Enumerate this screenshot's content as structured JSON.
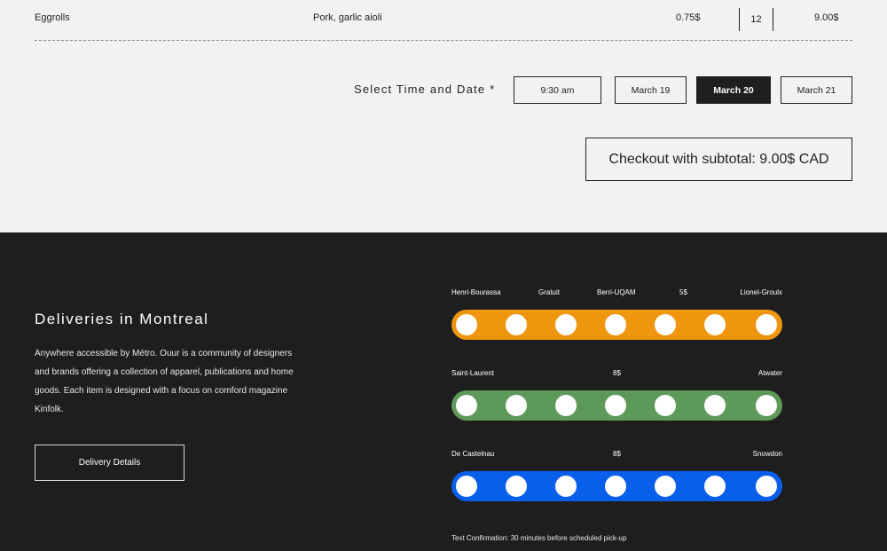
{
  "order": {
    "item_name": "Eggrolls",
    "item_description": "Pork, garlic aioli",
    "unit_price": "0.75$",
    "quantity": "12",
    "line_total": "9.00$"
  },
  "schedule": {
    "label": "Select Time and Date *",
    "time": "9:30 am",
    "dates": [
      "March 19",
      "March 20",
      "March 21"
    ],
    "selected_date": "March 20"
  },
  "checkout": {
    "label": "Checkout with subtotal: 9.00$ CAD"
  },
  "deliveries": {
    "title": "Deliveries in Montreal",
    "body": "Anywhere accessible by Métro. Ouur is a community of designers and brands offering a collection of apparel, publications and home goods. Each item is designed with a focus on comford magazine Kinfolk.",
    "button_label": "Delivery Details"
  },
  "metro_lines": [
    {
      "color": "#f0960e",
      "labels": [
        "Henri-Bourassa",
        "Gratuit",
        "Berri-UQAM",
        "5$",
        "Lionel-Groulx"
      ],
      "stops": 7
    },
    {
      "color": "#5d9a5a",
      "labels": [
        "Saint-Laurent",
        "8$",
        "Atwater"
      ],
      "stops": 7
    },
    {
      "color": "#0a5fea",
      "labels": [
        "De Castelnau",
        "8$",
        "Snowdon"
      ],
      "stops": 7
    }
  ],
  "confirmation": "Text Confirmation: 30 minutes before scheduled pick-up"
}
